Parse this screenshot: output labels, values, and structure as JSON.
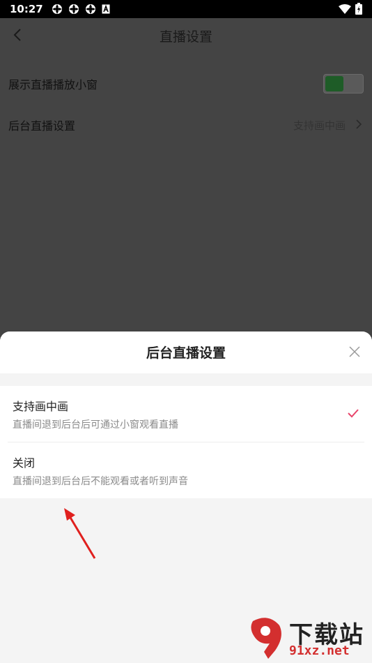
{
  "status_bar": {
    "time": "10:27"
  },
  "page": {
    "title": "直播设置",
    "rows": [
      {
        "label": "展示直播播放小窗",
        "toggle_on": true
      },
      {
        "label": "后台直播设置",
        "value": "支持画中画"
      }
    ]
  },
  "sheet": {
    "title": "后台直播设置",
    "options": [
      {
        "name": "支持画中画",
        "desc": "直播间退到后台后可通过小窗观看直播",
        "selected": true
      },
      {
        "name": "关闭",
        "desc": "直播间退到后台后不能观看或者听到声音",
        "selected": false
      }
    ]
  },
  "watermark": {
    "brand": "下载站",
    "domain": "91xz.net"
  },
  "colors": {
    "check": "#e8456b",
    "arrow": "#e0201e",
    "toggle_on": "#1e5c27"
  }
}
